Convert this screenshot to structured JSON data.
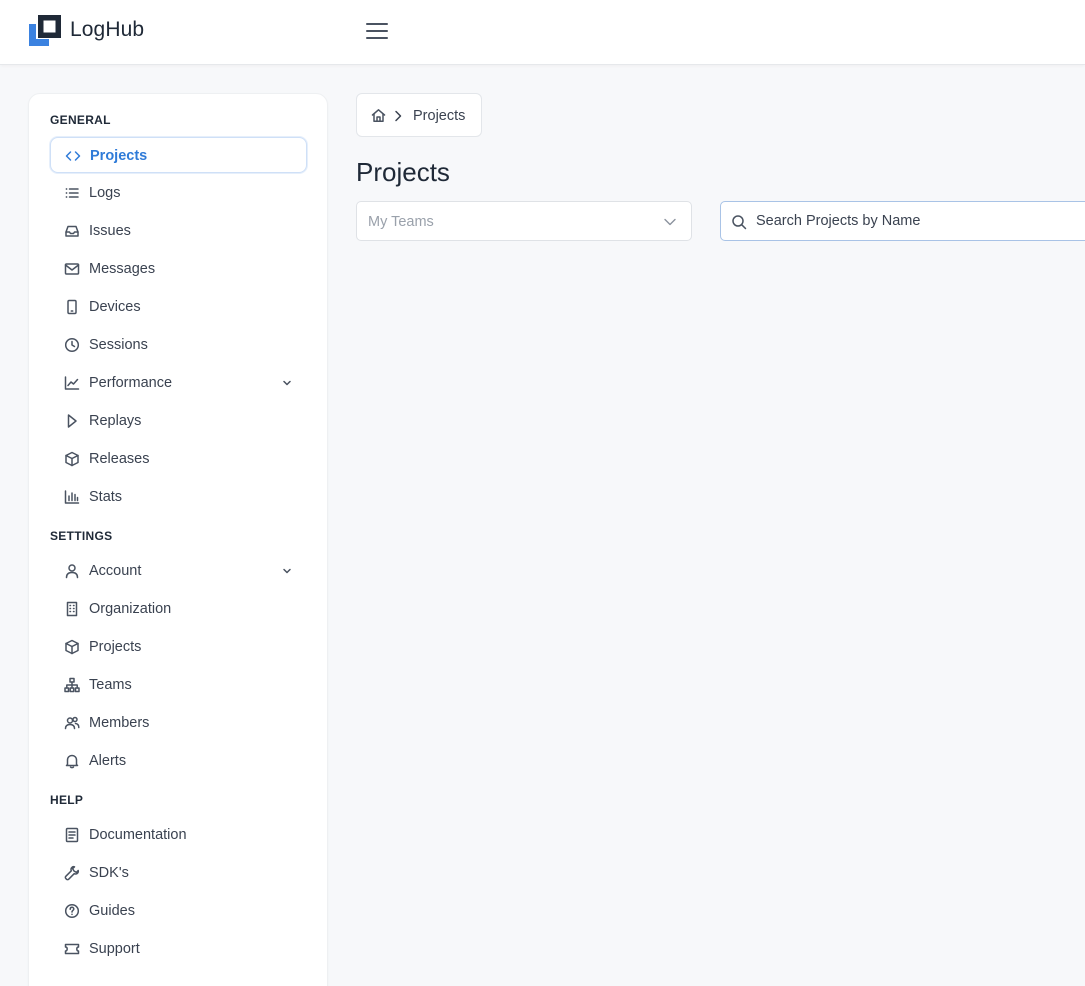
{
  "app": {
    "brand": "LogHub",
    "logo_colors": {
      "dark": "#1f2937",
      "accent": "#3b82e0"
    }
  },
  "header": {
    "menu_icon": "hamburger-icon"
  },
  "sidebar": {
    "sections": [
      {
        "title": "GENERAL",
        "items": [
          {
            "label": "Projects",
            "icon": "code-icon",
            "active": true
          },
          {
            "label": "Logs",
            "icon": "list-icon"
          },
          {
            "label": "Issues",
            "icon": "inbox-icon"
          },
          {
            "label": "Messages",
            "icon": "mail-icon"
          },
          {
            "label": "Devices",
            "icon": "phone-icon"
          },
          {
            "label": "Sessions",
            "icon": "clock-icon"
          },
          {
            "label": "Performance",
            "icon": "line-chart-icon",
            "expandable": true
          },
          {
            "label": "Replays",
            "icon": "play-icon"
          },
          {
            "label": "Releases",
            "icon": "package-icon"
          },
          {
            "label": "Stats",
            "icon": "bar-chart-icon"
          }
        ]
      },
      {
        "title": "SETTINGS",
        "items": [
          {
            "label": "Account",
            "icon": "user-icon",
            "expandable": true
          },
          {
            "label": "Organization",
            "icon": "building-icon"
          },
          {
            "label": "Projects",
            "icon": "package-icon"
          },
          {
            "label": "Teams",
            "icon": "hierarchy-icon"
          },
          {
            "label": "Members",
            "icon": "users-icon"
          },
          {
            "label": "Alerts",
            "icon": "bell-icon"
          }
        ]
      },
      {
        "title": "HELP",
        "items": [
          {
            "label": "Documentation",
            "icon": "document-icon"
          },
          {
            "label": "SDK's",
            "icon": "wrench-icon"
          },
          {
            "label": "Guides",
            "icon": "help-circle-icon"
          },
          {
            "label": "Support",
            "icon": "ticket-icon"
          }
        ]
      }
    ]
  },
  "breadcrumb": {
    "home_icon": "home-icon",
    "current": "Projects"
  },
  "main": {
    "title": "Projects",
    "team_select": {
      "placeholder": "My Teams"
    },
    "search": {
      "placeholder": "Search Projects by Name"
    }
  },
  "colors": {
    "accent": "#2f7bd8",
    "background": "#f7f8fa",
    "text": "#1f2937"
  }
}
